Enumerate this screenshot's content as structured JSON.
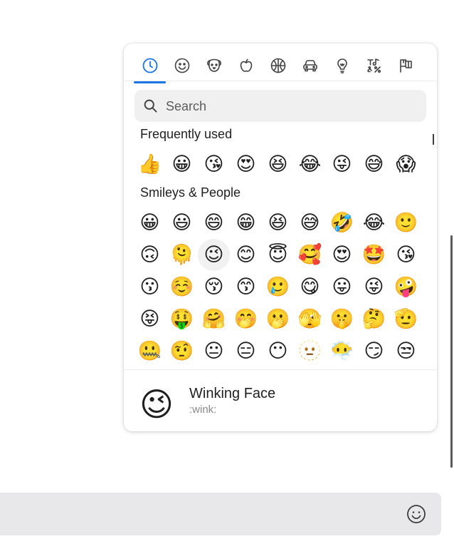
{
  "picker": {
    "tabs": [
      {
        "name": "recent-icon",
        "active": true
      },
      {
        "name": "smiley-icon",
        "active": false
      },
      {
        "name": "dog-icon",
        "active": false
      },
      {
        "name": "apple-icon",
        "active": false
      },
      {
        "name": "basketball-icon",
        "active": false
      },
      {
        "name": "car-icon",
        "active": false
      },
      {
        "name": "lightbulb-icon",
        "active": false
      },
      {
        "name": "symbols-icon",
        "active": false
      },
      {
        "name": "flags-icon",
        "active": false
      }
    ],
    "accent": "#1a73e8",
    "search": {
      "placeholder": "Search",
      "value": ""
    },
    "sections": [
      {
        "title": "Frequently used",
        "rows": [
          [
            "👍",
            "😀",
            "😘",
            "😍",
            "😆",
            "😂",
            "😜",
            "😅",
            "😱"
          ]
        ]
      },
      {
        "title": "Smileys & People",
        "rows": [
          [
            "😀",
            "😃",
            "😄",
            "😁",
            "😆",
            "😅",
            "🤣",
            "😂",
            "🙂"
          ],
          [
            "🙃",
            "🫠",
            "😉",
            "😊",
            "😇",
            "🥰",
            "😍",
            "🤩",
            "😘"
          ],
          [
            "😗",
            "☺️",
            "😚",
            "😙",
            "🥲",
            "😋",
            "😛",
            "😜",
            "🤪"
          ],
          [
            "😝",
            "🤑",
            "🤗",
            "🤭",
            "🫢",
            "🫣",
            "🤫",
            "🤔",
            "🫡"
          ],
          [
            "🤐",
            "🤨",
            "😐",
            "😑",
            "😶",
            "🫥",
            "😶‍🌫️",
            "😏",
            "😒"
          ]
        ]
      }
    ],
    "selected": {
      "emoji": "😉",
      "name": "Winking Face",
      "shortcode": ":wink:"
    }
  },
  "composer": {
    "emoji_button": "smiley-icon"
  }
}
